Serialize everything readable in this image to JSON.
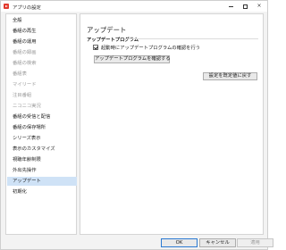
{
  "window": {
    "title": "アプリの設定",
    "icon": "app-play-icon",
    "controls": {
      "minimize": "minimize-icon",
      "maximize": "maximize-icon",
      "close": "×"
    }
  },
  "sidebar": {
    "items": [
      {
        "label": "全般",
        "state": "normal"
      },
      {
        "label": "番組の再生",
        "state": "normal"
      },
      {
        "label": "番組の運用",
        "state": "normal"
      },
      {
        "label": "番組の録画",
        "state": "disabled"
      },
      {
        "label": "番組の検索",
        "state": "disabled"
      },
      {
        "label": "番組表",
        "state": "disabled"
      },
      {
        "label": "マイリード",
        "state": "disabled"
      },
      {
        "label": "注目番組",
        "state": "disabled"
      },
      {
        "label": "ニコニコ実況",
        "state": "disabled"
      },
      {
        "label": "番組の受信と配信",
        "state": "normal"
      },
      {
        "label": "番組の保存場所",
        "state": "normal"
      },
      {
        "label": "シリーズ表示",
        "state": "normal"
      },
      {
        "label": "表示のカスタマイズ",
        "state": "normal"
      },
      {
        "label": "視聴年齢制限",
        "state": "normal"
      },
      {
        "label": "外出先操作",
        "state": "normal"
      },
      {
        "label": "アップデート",
        "state": "selected"
      },
      {
        "label": "初期化",
        "state": "normal"
      }
    ]
  },
  "content": {
    "section_title": "アップデート",
    "group_heading": "アップデートプログラム",
    "checkbox_label": "起動時にアップデートプログラムの確認を行う",
    "checkbox_checked": true,
    "check_update_button": "アップデートプログラムを確認する",
    "reset_button": "設定を既定値に戻す"
  },
  "footer": {
    "ok": "OK",
    "cancel": "キャンセル",
    "apply": "適用"
  },
  "colors": {
    "selected_item_bg": "#cfe2f6",
    "accent": "#2a79d2",
    "app_icon": "#e23a2e"
  }
}
